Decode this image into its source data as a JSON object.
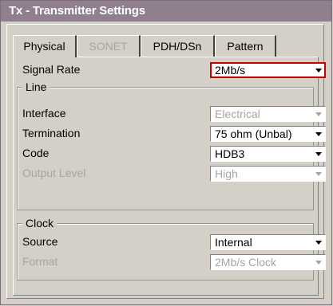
{
  "window": {
    "title": "Tx - Transmitter Settings"
  },
  "tabs": [
    {
      "label": "Physical",
      "state": "active"
    },
    {
      "label": "SONET",
      "state": "disabled"
    },
    {
      "label": "PDH/DSn",
      "state": "normal"
    },
    {
      "label": "Pattern",
      "state": "normal"
    }
  ],
  "signal_rate": {
    "label": "Signal Rate",
    "value": "2Mb/s"
  },
  "line": {
    "title": "Line",
    "interface": {
      "label": "Interface",
      "value": "Electrical",
      "enabled": false
    },
    "termination": {
      "label": "Termination",
      "value": "75 ohm (Unbal)",
      "enabled": true
    },
    "code": {
      "label": "Code",
      "value": "HDB3",
      "enabled": true
    },
    "output_level": {
      "label": "Output Level",
      "value": "High",
      "enabled": false
    }
  },
  "clock": {
    "title": "Clock",
    "source": {
      "label": "Source",
      "value": "Internal",
      "enabled": true
    },
    "format": {
      "label": "Format",
      "value": "2Mb/s Clock",
      "enabled": false
    }
  },
  "colors": {
    "titlebar": "#8f7f8f",
    "window_bg": "#d4d0c8",
    "highlight_border": "#c80000",
    "disabled_text": "#a8a4a0"
  }
}
